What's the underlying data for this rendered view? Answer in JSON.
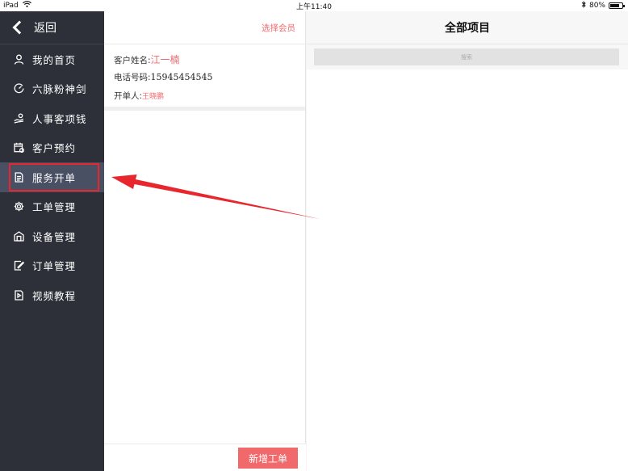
{
  "status_bar": {
    "device": "iPad",
    "time": "上午11:40",
    "battery": "80%",
    "battery_level": 0.8
  },
  "sidebar": {
    "back_label": "返回",
    "items": [
      {
        "label": "我的首页",
        "icon": "person-icon"
      },
      {
        "label": "六脉粉神剑",
        "icon": "gauge-icon"
      },
      {
        "label": "人事客项钱",
        "icon": "hand-coin-icon"
      },
      {
        "label": "客户预约",
        "icon": "calendar-icon"
      },
      {
        "label": "服务开单",
        "icon": "document-icon",
        "active": true
      },
      {
        "label": "工单管理",
        "icon": "gear-icon"
      },
      {
        "label": "设备管理",
        "icon": "building-icon"
      },
      {
        "label": "订单管理",
        "icon": "edit-doc-icon"
      },
      {
        "label": "视频教程",
        "icon": "video-doc-icon"
      }
    ]
  },
  "middle": {
    "select_member": "选择会员",
    "customer_name_label": "客户姓名:",
    "customer_name": "江一楠",
    "phone_label": "电话号码:",
    "phone": "15945454545",
    "opener_label": "开单人:",
    "opener": "王晓鹏",
    "add_button": "新增工单"
  },
  "right": {
    "title": "全部项目",
    "search_placeholder": "搜索"
  },
  "colors": {
    "accent": "#f2696c",
    "sidebar_bg": "#2d3038",
    "sidebar_active": "#4a5064",
    "annotation_red": "#e8262d"
  }
}
